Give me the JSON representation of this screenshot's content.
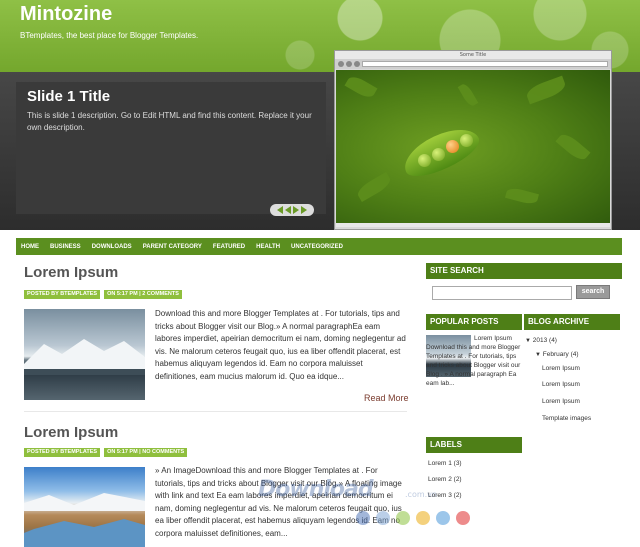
{
  "header": {
    "site_title": "Mintozine",
    "tagline": "BTemplates, the best place for Blogger Templates."
  },
  "slider": {
    "title": "Slide 1 Title",
    "description": "This is slide 1 description. Go to Edit HTML and find this content. Replace it your own description.",
    "browser_title": "Some Title"
  },
  "nav": {
    "items": [
      "HOME",
      "BUSINESS",
      "DOWNLOADS",
      "PARENT CATEGORY",
      "FEATURED",
      "HEALTH",
      "UNCATEGORIZED"
    ]
  },
  "posts": [
    {
      "title": "Lorem Ipsum",
      "author": "POSTED BY BTEMPLATES",
      "time_comments": "ON 5:17 PM | 2 COMMENTS",
      "excerpt": "Download this and more Blogger Templates at . For tutorials, tips and tricks about Blogger visit our Blog.» A normal paragraphEa eam labores imperdiet, apeirian democritum ei nam, doming neglegentur ad vis. Ne malorum ceteros feugait quo, ius ea liber offendit placerat, est habemus aliquyam legendos id. Eam no corpora maluisset definitiones, eam mucius malorum id. Quo ea idque...",
      "read_more": "Read More"
    },
    {
      "title": "Lorem Ipsum",
      "author": "POSTED BY BTEMPLATES",
      "time_comments": "ON 5:17 PM | NO COMMENTS",
      "excerpt": "» An ImageDownload this and more Blogger Templates at . For tutorials, tips and tricks about Blogger visit our Blog.» A floating image with link and text Ea eam labores imperdiet, apeirian democritum ei nam, doming neglegentur ad vis. Ne malorum ceteros feugait quo, ius ea liber offendit placerat, est habemus aliquyam legendos id. Eam no corpora maluisset definitiones, eam..."
    }
  ],
  "sidebar": {
    "site_search_heading": "SITE SEARCH",
    "search_button": "search",
    "popular_posts_heading": "POPULAR POSTS",
    "popular_post_text": "Lorem Ipsum Download this and more Blogger Templates at . For tutorials, tips and tricks about Blogger visit our Blog . » A normal paragraph Ea eam lab...",
    "labels_heading": "LABELS",
    "labels": [
      "Lorem 1 (3)",
      "Lorem 2 (2)",
      "Lorem 3 (2)"
    ],
    "archive_heading": "BLOG ARCHIVE",
    "archive_year": "2013 (4)",
    "archive_month": "February (4)",
    "archive_posts": [
      "Lorem Ipsum",
      "Lorem Ipsum",
      "Lorem Ipsum",
      "Template images"
    ]
  },
  "watermark": {
    "brand": "Download",
    "tld": ".com.vn"
  },
  "colors": {
    "header_green": "#74a72d",
    "nav_green": "#5b8f1f",
    "sidebar_head": "#4e7f17",
    "meta_green": "#8fbf3d",
    "read_more": "#7a3b2e"
  }
}
